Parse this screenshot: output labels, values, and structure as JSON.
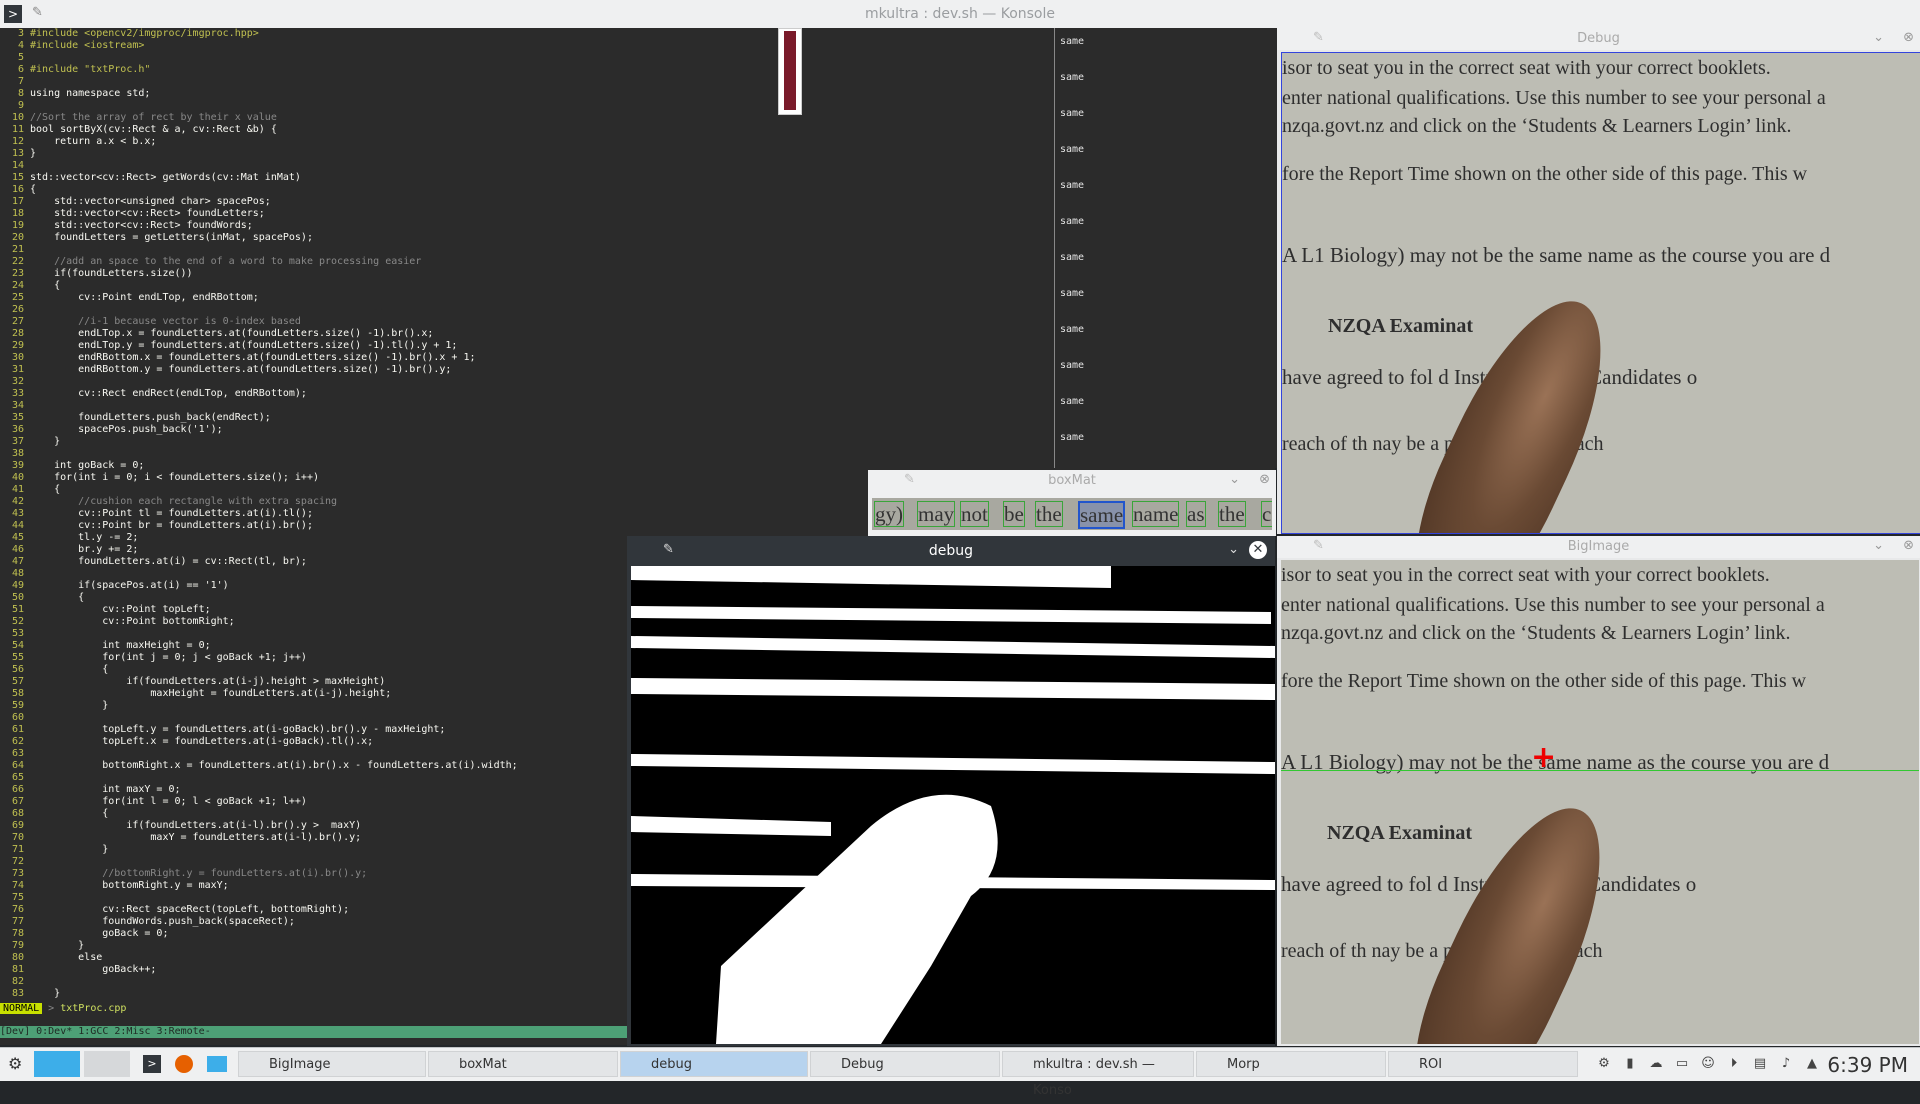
{
  "konsole": {
    "title": "mkultra : dev.sh — Konsole",
    "editor_lines": [
      {
        "n": "3",
        "t": "#include <opencv2/imgproc/imgproc.hpp>"
      },
      {
        "n": "4",
        "t": "#include <iostream>"
      },
      {
        "n": "5",
        "t": ""
      },
      {
        "n": "6",
        "t": "#include \"txtProc.h\""
      },
      {
        "n": "7",
        "t": ""
      },
      {
        "n": "8",
        "t": "using namespace std;"
      },
      {
        "n": "9",
        "t": ""
      },
      {
        "n": "10",
        "t": "//Sort the array of rect by their x value"
      },
      {
        "n": "11",
        "t": "bool sortByX(cv::Rect & a, cv::Rect &b) {"
      },
      {
        "n": "12",
        "t": "    return a.x < b.x;"
      },
      {
        "n": "13",
        "t": "}"
      },
      {
        "n": "14",
        "t": ""
      },
      {
        "n": "15",
        "t": "std::vector<cv::Rect> getWords(cv::Mat inMat)"
      },
      {
        "n": "16",
        "t": "{"
      },
      {
        "n": "17",
        "t": "    std::vector<unsigned char> spacePos;"
      },
      {
        "n": "18",
        "t": "    std::vector<cv::Rect> foundLetters;"
      },
      {
        "n": "19",
        "t": "    std::vector<cv::Rect> foundWords;"
      },
      {
        "n": "20",
        "t": "    foundLetters = getLetters(inMat, spacePos);"
      },
      {
        "n": "21",
        "t": ""
      },
      {
        "n": "22",
        "t": "    //add an space to the end of a word to make processing easier"
      },
      {
        "n": "23",
        "t": "    if(foundLetters.size())"
      },
      {
        "n": "24",
        "t": "    {"
      },
      {
        "n": "25",
        "t": "        cv::Point endLTop, endRBottom;"
      },
      {
        "n": "26",
        "t": ""
      },
      {
        "n": "27",
        "t": "        //i-1 because vector is 0-index based"
      },
      {
        "n": "28",
        "t": "        endLTop.x = foundLetters.at(foundLetters.size() -1).br().x;"
      },
      {
        "n": "29",
        "t": "        endLTop.y = foundLetters.at(foundLetters.size() -1).tl().y + 1;"
      },
      {
        "n": "30",
        "t": "        endRBottom.x = foundLetters.at(foundLetters.size() -1).br().x + 1;"
      },
      {
        "n": "31",
        "t": "        endRBottom.y = foundLetters.at(foundLetters.size() -1).br().y;"
      },
      {
        "n": "32",
        "t": ""
      },
      {
        "n": "33",
        "t": "        cv::Rect endRect(endLTop, endRBottom);"
      },
      {
        "n": "34",
        "t": ""
      },
      {
        "n": "35",
        "t": "        foundLetters.push_back(endRect);"
      },
      {
        "n": "36",
        "t": "        spacePos.push_back('1');"
      },
      {
        "n": "37",
        "t": "    }"
      },
      {
        "n": "38",
        "t": ""
      },
      {
        "n": "39",
        "t": "    int goBack = 0;"
      },
      {
        "n": "40",
        "t": "    for(int i = 0; i < foundLetters.size(); i++)"
      },
      {
        "n": "41",
        "t": "    {"
      },
      {
        "n": "42",
        "t": "        //cushion each rectangle with extra spacing"
      },
      {
        "n": "43",
        "t": "        cv::Point tl = foundLetters.at(i).tl();"
      },
      {
        "n": "44",
        "t": "        cv::Point br = foundLetters.at(i).br();"
      },
      {
        "n": "45",
        "t": "        tl.y -= 2;"
      },
      {
        "n": "46",
        "t": "        br.y += 2;"
      },
      {
        "n": "47",
        "t": "        foundLetters.at(i) = cv::Rect(tl, br);"
      },
      {
        "n": "48",
        "t": ""
      },
      {
        "n": "49",
        "t": "        if(spacePos.at(i) == '1')"
      },
      {
        "n": "50",
        "t": "        {"
      },
      {
        "n": "51",
        "t": "            cv::Point topLeft;"
      },
      {
        "n": "52",
        "t": "            cv::Point bottomRight;"
      },
      {
        "n": "53",
        "t": ""
      },
      {
        "n": "54",
        "t": "            int maxHeight = 0;"
      },
      {
        "n": "55",
        "t": "            for(int j = 0; j < goBack +1; j++)"
      },
      {
        "n": "56",
        "t": "            {"
      },
      {
        "n": "57",
        "t": "                if(foundLetters.at(i-j).height > maxHeight)"
      },
      {
        "n": "58",
        "t": "                    maxHeight = foundLetters.at(i-j).height;"
      },
      {
        "n": "59",
        "t": "            }"
      },
      {
        "n": "60",
        "t": ""
      },
      {
        "n": "61",
        "t": "            topLeft.y = foundLetters.at(i-goBack).br().y - maxHeight;"
      },
      {
        "n": "62",
        "t": "            topLeft.x = foundLetters.at(i-goBack).tl().x;"
      },
      {
        "n": "63",
        "t": ""
      },
      {
        "n": "64",
        "t": "            bottomRight.x = foundLetters.at(i).br().x - foundLetters.at(i).width;"
      },
      {
        "n": "65",
        "t": ""
      },
      {
        "n": "66",
        "t": "            int maxY = 0;"
      },
      {
        "n": "67",
        "t": "            for(int l = 0; l < goBack +1; l++)"
      },
      {
        "n": "68",
        "t": "            {"
      },
      {
        "n": "69",
        "t": "                if(foundLetters.at(i-l).br().y >  maxY)"
      },
      {
        "n": "70",
        "t": "                    maxY = foundLetters.at(i-l).br().y;"
      },
      {
        "n": "71",
        "t": "            }"
      },
      {
        "n": "72",
        "t": ""
      },
      {
        "n": "73",
        "t": "            //bottomRight.y = foundLetters.at(i).br().y;"
      },
      {
        "n": "74",
        "t": "            bottomRight.y = maxY;"
      },
      {
        "n": "75",
        "t": ""
      },
      {
        "n": "76",
        "t": "            cv::Rect spaceRect(topLeft, bottomRight);"
      },
      {
        "n": "77",
        "t": "            foundWords.push_back(spaceRect);"
      },
      {
        "n": "78",
        "t": "            goBack = 0;"
      },
      {
        "n": "79",
        "t": "        }"
      },
      {
        "n": "80",
        "t": "        else"
      },
      {
        "n": "81",
        "t": "            goBack++;"
      },
      {
        "n": "82",
        "t": ""
      },
      {
        "n": "83",
        "t": "    }"
      }
    ],
    "mode": "NORMAL",
    "filename": "txtProc.cpp",
    "tmux_status": "[Dev] 0:Dev* 1:GCC  2:Misc  3:Remote-",
    "right_pane_lines": [
      "same",
      "same",
      "same",
      "same",
      "same",
      "same",
      "same",
      "same",
      "same",
      "same",
      "same",
      "same"
    ]
  },
  "debug_top": {
    "title": "Debug",
    "lines": [
      "isor to seat you in the correct seat with your correct booklets.",
      "enter national qualifications. Use this number to see your personal a",
      "nzqa.govt.nz and click on the ‘Students & Learners Login’ link.",
      "fore the Report Time shown on the other side of this page. This w",
      "A L1 Biology) may not be the same name as the course you are d",
      "NZQA Examinat",
      "have agreed to fol          d Instructions for Candidates o",
      "reach of th                      nay be a penalty for a breach"
    ]
  },
  "bigimage": {
    "title": "BigImage",
    "lines": [
      "isor to seat you in the correct seat with your correct booklets.",
      "enter national qualifications. Use this number to see your personal a",
      "nzqa.govt.nz and click on the ‘Students & Learners Login’ link.",
      "fore the Report Time shown on the other side of this page. This w",
      "A L1 Biology) may not be the same name as the course you are d",
      "NZQA Examinat",
      "have agreed to fol          d Instructions for Candidates o",
      "reach of th                      nay be a penalty for a breach"
    ]
  },
  "boxmat": {
    "title": "boxMat",
    "words": [
      "gy)",
      "may",
      "not",
      "be",
      "the",
      "same",
      "name",
      "as",
      "the",
      "cou"
    ]
  },
  "debug_bin": {
    "title": "debug"
  },
  "taskbar": {
    "tasks": [
      "BigImage",
      "boxMat",
      "debug",
      "Debug",
      "mkultra : dev.sh — Konso",
      "Morp",
      "ROI"
    ],
    "active_task": "debug",
    "clock": "6:39 PM"
  }
}
